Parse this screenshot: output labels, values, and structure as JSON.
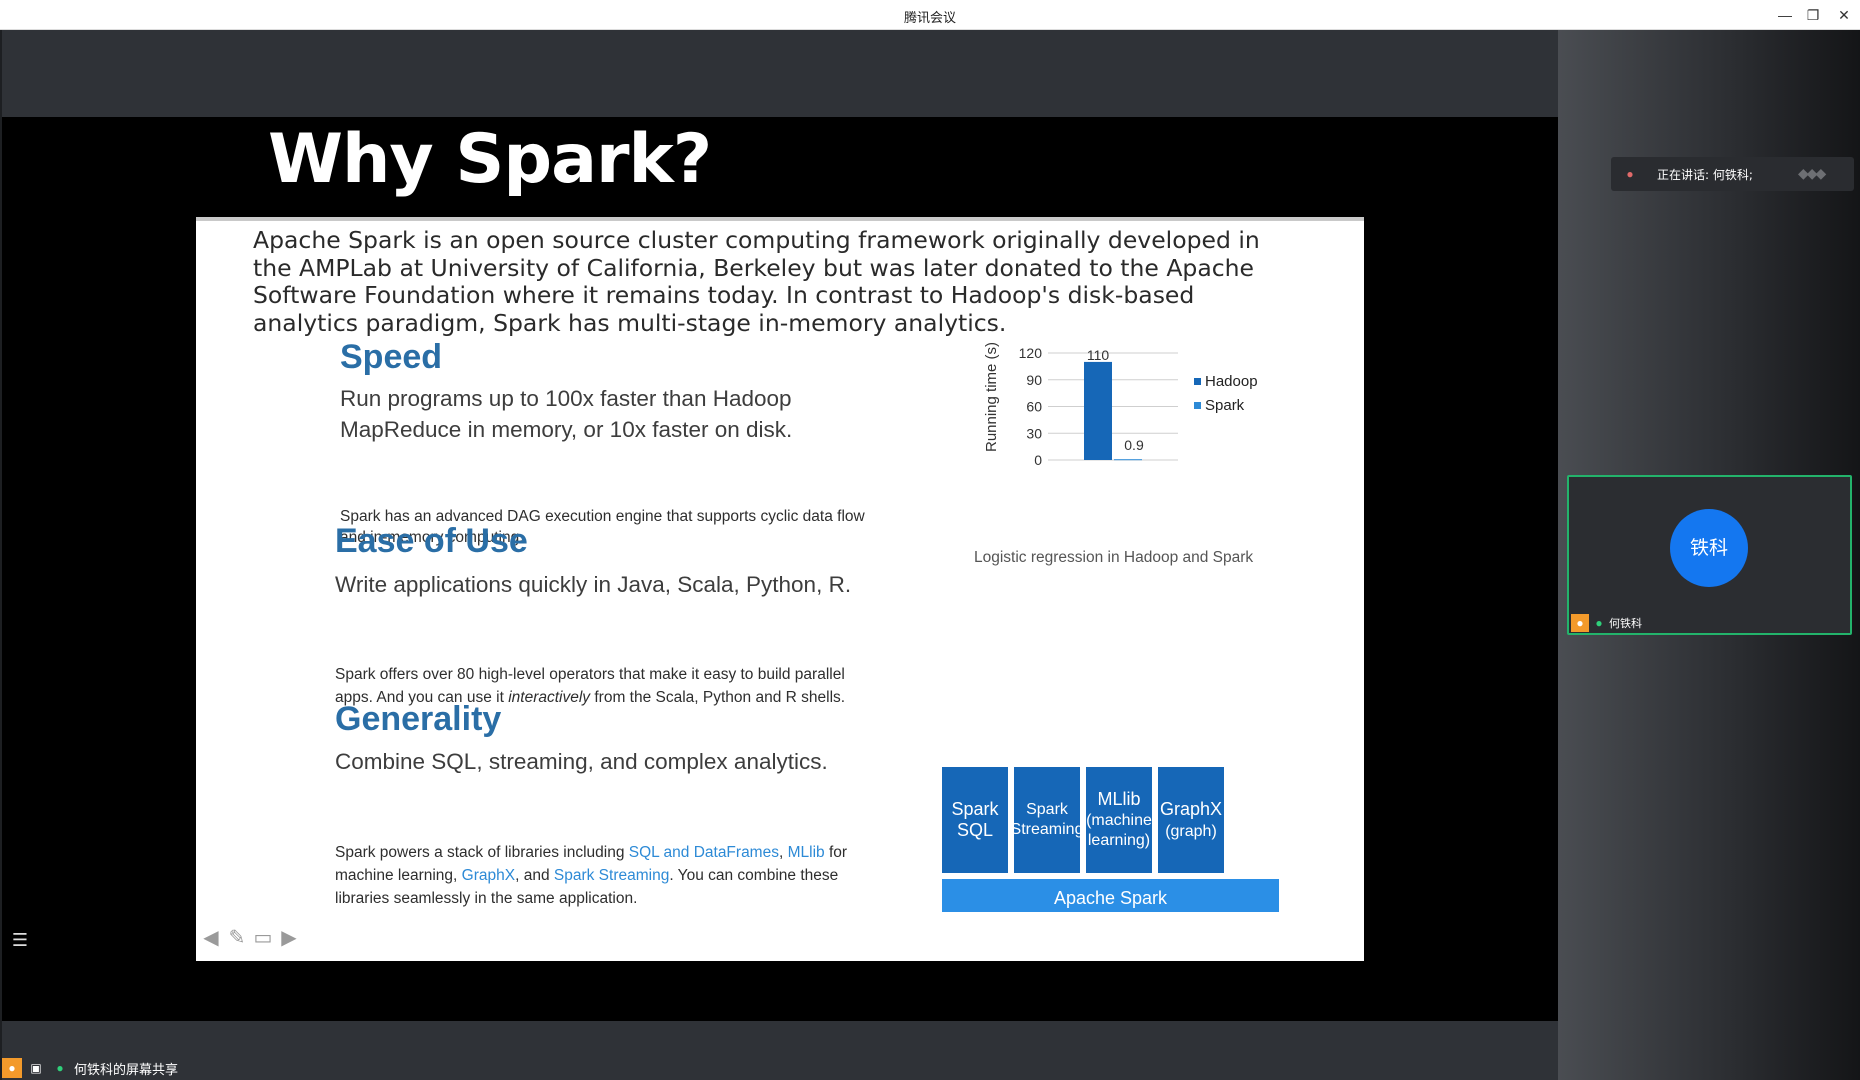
{
  "window": {
    "title": "腾讯会议"
  },
  "colors": {
    "accent_green": "#23b36b",
    "avatar_blue": "#1477f0",
    "slide_blue": "#2a6ea6",
    "stack_blue": "#1667b7",
    "link_blue": "#2d8ad6"
  },
  "slide": {
    "title": "Why Spark?",
    "intro": "Apache Spark is an open source cluster computing framework originally developed in the AMPLab at University of California, Berkeley but was later donated to the Apache Software Foundation where it remains today. In contrast to Hadoop's disk-based analytics paradigm, Spark has multi-stage in-memory analytics.",
    "speed": {
      "heading": "Speed",
      "lead_line1": "Run programs up to 100x faster than Hadoop",
      "lead_line2": "MapReduce in memory, or 10x faster on disk.",
      "detail_line1": "Spark has an advanced DAG execution engine that supports cyclic data flow",
      "detail_line2": "and in-memory computing."
    },
    "ease": {
      "heading": "Ease of Use",
      "lead": "Write applications quickly in Java, Scala, Python, R.",
      "detail_line1": "Spark offers over 80 high-level operators that make it easy to build parallel",
      "detail_line2_a": "apps. And you can use it ",
      "detail_line2_em": "interactively",
      "detail_line2_b": " from the Scala, Python and R shells."
    },
    "generality": {
      "heading": "Generality",
      "lead": "Combine SQL, streaming, and complex analytics.",
      "d1_a": "Spark powers a stack of libraries including ",
      "d1_link1": "SQL and DataFrames",
      "d1_b": ", ",
      "d1_link2": "MLlib",
      "d1_c": " for",
      "d2_a": "machine learning, ",
      "d2_link1": "GraphX",
      "d2_b": ", and ",
      "d2_link2": "Spark Streaming",
      "d2_c": ". You can combine these",
      "d3": "libraries seamlessly in the same application."
    },
    "chart_caption": "Logistic regression in Hadoop and Spark",
    "stack": {
      "box1": [
        "Spark",
        "SQL"
      ],
      "box2": [
        "Spark",
        "Streaming"
      ],
      "box3": [
        "MLlib",
        "(machine",
        "learning)"
      ],
      "box4": [
        "GraphX",
        "(graph)"
      ],
      "base": "Apache Spark"
    }
  },
  "chart_data": {
    "type": "bar",
    "categories": [
      "Hadoop",
      "Spark"
    ],
    "series": [
      {
        "name": "Hadoop",
        "values": [
          110
        ],
        "color": "#1667b7"
      },
      {
        "name": "Spark",
        "values": [
          0.9
        ],
        "color": "#2d8ad6"
      }
    ],
    "data_labels": [
      "110",
      "0.9"
    ],
    "ylabel": "Running time (s)",
    "ylim": [
      0,
      120
    ],
    "yticks": [
      0,
      30,
      60,
      90,
      120
    ],
    "grid": true,
    "legend": "right",
    "caption": "Logistic regression in Hadoop and Spark"
  },
  "right_panel": {
    "speaking_label": "正在讲话: 何铁科;",
    "avatar_text": "铁科",
    "participant_name": "何铁科"
  },
  "status": {
    "share_label": "何铁科的屏幕共享"
  },
  "icons": [
    "minimize-icon",
    "restore-icon",
    "close-icon",
    "arrow-left-icon",
    "pen-icon",
    "slide-menu-icon",
    "arrow-right-icon",
    "list-icon",
    "user-icon",
    "screen-share-icon",
    "mic-icon",
    "mic-muted-icon",
    "audio-wave-icon"
  ]
}
